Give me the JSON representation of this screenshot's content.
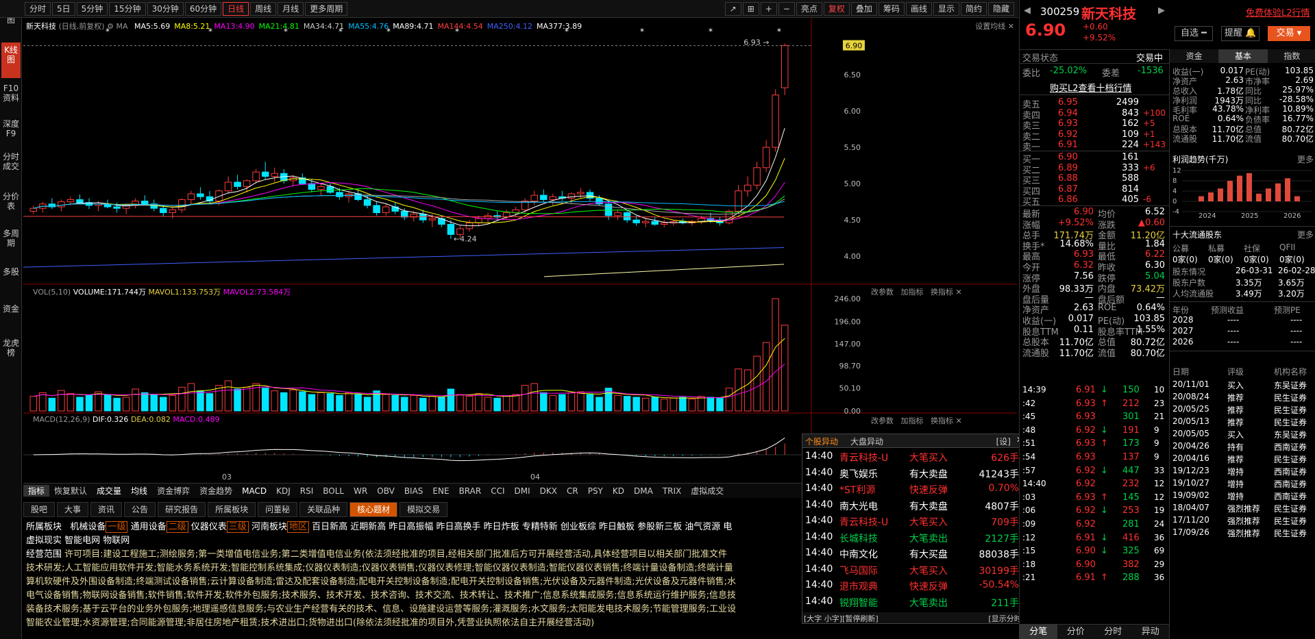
{
  "toolbar": {
    "periods": [
      "分时",
      "5日",
      "5分钟",
      "15分钟",
      "30分钟",
      "60分钟",
      "日线",
      "周线",
      "月线",
      "更多周期"
    ],
    "active_period": "日线",
    "right": [
      "亮点",
      "复权",
      "叠加",
      "筹码",
      "画线",
      "显示",
      "简约",
      "隐藏"
    ]
  },
  "leftnav": [
    "分时图",
    "K线图",
    "F10资料",
    "深度F9",
    "分时成交",
    "分价表",
    "多周期",
    "多股",
    "资金",
    "龙虎榜"
  ],
  "kchart": {
    "title": "新天科技",
    "subtitle": "(日线,前复权)",
    "ma_label": "MA",
    "ma": [
      {
        "name": "MA5",
        "value": "5.69",
        "color": "#ffffff"
      },
      {
        "name": "MA8",
        "value": "5.21",
        "color": "#ffff00"
      },
      {
        "name": "MA13",
        "value": "4.90",
        "color": "#ff00ff"
      },
      {
        "name": "MA21",
        "value": "4.81",
        "color": "#00ff00"
      },
      {
        "name": "MA34",
        "value": "4.71",
        "color": "#cccccc"
      },
      {
        "name": "MA55",
        "value": "4.76",
        "color": "#00bfff"
      },
      {
        "name": "MA89",
        "value": "4.71",
        "color": "#ffffff"
      },
      {
        "name": "MA144",
        "value": "4.54",
        "color": "#ff4040"
      },
      {
        "name": "MA250",
        "value": "4.12",
        "color": "#4060ff"
      },
      {
        "name": "MA377",
        "value": "3.89",
        "color": "#ffffff"
      }
    ],
    "settings_label": "设置均线",
    "price_axis": [
      "6.90",
      "6.50",
      "6.00",
      "5.50",
      "5.00",
      "4.50",
      "4.00"
    ],
    "high_label": "6.93",
    "low_label": "4.24",
    "highlight_price": "6.90",
    "ylim": [
      3.7,
      7.0
    ]
  },
  "volchart": {
    "label": "VOL(5,10)",
    "volume": "VOLUME:171.744万",
    "mavol1": "MAVOL1:133.753万",
    "mavol2": "MAVOL2:73.584万",
    "axis": [
      "246.00",
      "196.00",
      "147.00",
      "98.70",
      "50.10",
      "0.00"
    ],
    "actions": [
      "改参数",
      "加指标",
      "换指标"
    ],
    "ylim": [
      0,
      246
    ]
  },
  "macdchart": {
    "label": "MACD(12,26,9)",
    "dif": "DIF:0.326",
    "dea": "DEA:0.082",
    "macd": "MACD:0.489",
    "actions": [
      "改参数",
      "加指标",
      "换指标"
    ],
    "x_labels": [
      "03",
      "04"
    ]
  },
  "indicators": [
    "指标",
    "恢复默认",
    "成交量",
    "均线",
    "资金博弈",
    "资金趋势",
    "MACD",
    "KDJ",
    "RSI",
    "BOLL",
    "WR",
    "OBV",
    "BIAS",
    "ENE",
    "BRAR",
    "CCI",
    "DMI",
    "DKX",
    "CR",
    "PSY",
    "KD",
    "DMA",
    "TRIX",
    "虚拟成交"
  ],
  "f10_tabs": [
    "股吧",
    "大事",
    "资讯",
    "公告",
    "研究报告",
    "所属板块",
    "问董秘",
    "关联品种",
    "核心题材",
    "模拟交易"
  ],
  "f10_active": "核心题材",
  "f10": {
    "sector_label": "所属板块",
    "sectors": [
      {
        "name": "机械设备",
        "tag": "一级"
      },
      {
        "name": "通用设备",
        "tag": "二级"
      },
      {
        "name": "仪器仪表",
        "tag": "三级"
      },
      {
        "name": "河南板块",
        "tag": "地区"
      }
    ],
    "concepts": "百日新高  近期新高  昨日高振幅  昨日高换手  昨日炸板  专精特新  创业板综  昨日触板  参股新三板  油气资源  电",
    "concepts2": "虚拟现实  智能电网  物联网",
    "scope_label": "经营范围",
    "scope_lines": [
      "许可项目:建设工程施工;测绘服务;第一类增值电信业务;第二类增值电信业务(依法须经批准的项目,经相关部门批准后方可开展经营活动,具体经营项目以相关部门批准文件",
      "技术研发;人工智能应用软件开发;智能水务系统开发;智能控制系统集成;仪器仪表制造;仪器仪表销售;仪器仪表修理;智能仪器仪表制造;智能仪器仪表销售;终端计量设备制造;终端计量",
      "算机软硬件及外围设备制造;终端测试设备销售;云计算设备制造;雷达及配套设备制造;配电开关控制设备制造;配电开关控制设备销售;光伏设备及元器件制造;光伏设备及元器件销售;水",
      "电气设备销售;物联网设备销售;软件销售;软件开发;软件外包服务;技术服务、技术开发、技术咨询、技术交流、技术转让、技术推广;信息系统集成服务;信息系统运行维护服务;信息技",
      "装备技术服务;基于云平台的业务外包服务;地理遥感信息服务;与农业生产经营有关的技术、信息、设施建设运营等服务;灌溉服务;水文服务;太阳能发电技术服务;节能管理服务;工业设",
      "智能农业管理;水资源管理;合同能源管理;非居住房地产租赁;技术进出口;货物进出口(除依法须经批准的项目外,凭营业执照依法自主开展经营活动)"
    ]
  },
  "popup": {
    "tabs": [
      "个股异动",
      "大盘异动"
    ],
    "settings": "[设]",
    "rows": [
      {
        "time": "14:40",
        "name": "青云科技-U",
        "type": "大笔买入",
        "value": "626手",
        "color": "red"
      },
      {
        "time": "14:40",
        "name": "奥飞娱乐",
        "type": "有大卖盘",
        "value": "41243手",
        "color": "white"
      },
      {
        "time": "14:40",
        "name": "*ST利源",
        "type": "快速反弹",
        "value": "0.70%",
        "color": "red"
      },
      {
        "time": "14:40",
        "name": "南大光电",
        "type": "有大卖盘",
        "value": "4807手",
        "color": "white"
      },
      {
        "time": "14:40",
        "name": "青云科技-U",
        "type": "大笔买入",
        "value": "709手",
        "color": "red"
      },
      {
        "time": "14:40",
        "name": "长城科技",
        "type": "大笔卖出",
        "value": "2127手",
        "color": "green"
      },
      {
        "time": "14:40",
        "name": "中南文化",
        "type": "有大买盘",
        "value": "88038手",
        "color": "white"
      },
      {
        "time": "14:40",
        "name": "飞马国际",
        "type": "大笔买入",
        "value": "30199手",
        "color": "red"
      },
      {
        "time": "14:40",
        "name": "退市观典",
        "type": "快速反弹",
        "value": "-50.54%",
        "color": "red"
      },
      {
        "time": "14:40",
        "name": "锐翔智能",
        "type": "大笔卖出",
        "value": "211手",
        "color": "green"
      }
    ],
    "footer_left": "[大字 小字][暂停刷新]",
    "footer_right": "[显示分时]"
  },
  "quote": {
    "code": "300259",
    "name": "新天科技",
    "price": "6.90",
    "change": "+0.60",
    "change_pct": "+9.52%",
    "free_l2": "免费体验L2行情",
    "buttons": [
      "自选",
      "提醒",
      "交易"
    ],
    "trade_status_label": "交易状态",
    "trade_status": "交易中",
    "weibi_label": "委比",
    "weibi": "-25.02%",
    "weicha_label": "委差",
    "weicha": "-1536",
    "buy_l2": "购买L2查看十档行情",
    "asks": [
      {
        "label": "卖五",
        "price": "6.95",
        "vol": "2499",
        "chg": ""
      },
      {
        "label": "卖四",
        "price": "6.94",
        "vol": "843",
        "chg": "+100"
      },
      {
        "label": "卖三",
        "price": "6.93",
        "vol": "162",
        "chg": "+5"
      },
      {
        "label": "卖二",
        "price": "6.92",
        "vol": "109",
        "chg": "+1"
      },
      {
        "label": "卖一",
        "price": "6.91",
        "vol": "224",
        "chg": "+143"
      }
    ],
    "bids": [
      {
        "label": "买一",
        "price": "6.90",
        "vol": "161",
        "chg": ""
      },
      {
        "label": "买二",
        "price": "6.89",
        "vol": "333",
        "chg": "+6"
      },
      {
        "label": "买三",
        "price": "6.88",
        "vol": "588",
        "chg": ""
      },
      {
        "label": "买四",
        "price": "6.87",
        "vol": "814",
        "chg": ""
      },
      {
        "label": "买五",
        "price": "6.86",
        "vol": "405",
        "chg": "-6"
      }
    ],
    "stats": [
      [
        "最新",
        "6.90",
        "均价",
        "6.52"
      ],
      [
        "涨幅",
        "+9.52%",
        "涨跌",
        "▲0.60"
      ],
      [
        "总手",
        "171.74万",
        "金额",
        "11.20亿"
      ],
      [
        "换手*",
        "14.68%",
        "量比",
        "1.84"
      ],
      [
        "最高",
        "6.93",
        "最低",
        "6.22"
      ],
      [
        "今开",
        "6.32",
        "昨收",
        "6.30"
      ],
      [
        "涨停",
        "7.56",
        "跌停",
        "5.04"
      ],
      [
        "外盘",
        "98.33万",
        "内盘",
        "73.42万"
      ],
      [
        "盘后量",
        "—",
        "盘后额",
        "—"
      ],
      [
        "净资产",
        "2.63",
        "ROE",
        "0.64%"
      ],
      [
        "收益(一)",
        "0.017",
        "PE(动)",
        "103.85"
      ],
      [
        "股息TTM",
        "0.11",
        "股息率TTM",
        "1.55%"
      ],
      [
        "总股本",
        "11.70亿",
        "总值",
        "80.72亿"
      ],
      [
        "流通股",
        "11.70亿",
        "流值",
        "80.70亿"
      ]
    ]
  },
  "ticks": [
    {
      "time": "14:39",
      "price": "6.91",
      "arrow": "↓",
      "vol": "150",
      "n": "10"
    },
    {
      "time": ":42",
      "price": "6.93",
      "arrow": "↑",
      "vol": "212",
      "n": "23"
    },
    {
      "time": ":45",
      "price": "6.93",
      "arrow": "",
      "vol": "301",
      "n": "21"
    },
    {
      "time": ":48",
      "price": "6.92",
      "arrow": "↓",
      "vol": "191",
      "n": "9"
    },
    {
      "time": ":51",
      "price": "6.93",
      "arrow": "↑",
      "vol": "173",
      "n": "9"
    },
    {
      "time": ":54",
      "price": "6.93",
      "arrow": "",
      "vol": "137",
      "n": "9"
    },
    {
      "time": ":57",
      "price": "6.92",
      "arrow": "↓",
      "vol": "447",
      "n": "33"
    },
    {
      "time": "14:40",
      "price": "6.92",
      "arrow": "",
      "vol": "232",
      "n": "12"
    },
    {
      "time": ":03",
      "price": "6.93",
      "arrow": "↑",
      "vol": "145",
      "n": "12"
    },
    {
      "time": ":06",
      "price": "6.92",
      "arrow": "↓",
      "vol": "253",
      "n": "19"
    },
    {
      "time": ":09",
      "price": "6.92",
      "arrow": "",
      "vol": "281",
      "n": "24"
    },
    {
      "time": ":12",
      "price": "6.91",
      "arrow": "↓",
      "vol": "416",
      "n": "36"
    },
    {
      "time": ":15",
      "price": "6.90",
      "arrow": "↓",
      "vol": "325",
      "n": "69"
    },
    {
      "time": ":18",
      "price": "6.90",
      "arrow": "",
      "vol": "382",
      "n": "29"
    },
    {
      "time": ":21",
      "price": "6.91",
      "arrow": "↑",
      "vol": "288",
      "n": "36"
    }
  ],
  "tick_tabs": [
    "分笔",
    "分价",
    "分时",
    "异动"
  ],
  "fundamentals": {
    "tabs": [
      "资金",
      "基本",
      "指数"
    ],
    "active": "基本",
    "rows": [
      [
        "收益(一)",
        "0.017",
        "PE(动)",
        "103.85"
      ],
      [
        "净资产",
        "2.63",
        "市净率",
        "2.69"
      ],
      [
        "总收入",
        "1.78亿",
        "同比",
        "25.97%"
      ],
      [
        "净利润",
        "1943万",
        "同比",
        "-28.58%"
      ],
      [
        "毛利率",
        "43.78%",
        "净利率",
        "10.89%"
      ],
      [
        "ROE",
        "0.64%",
        "负债率",
        "16.77%"
      ],
      [
        "总股本",
        "11.70亿",
        "总值",
        "80.72亿"
      ],
      [
        "流通股",
        "11.70亿",
        "流值",
        "80.70亿"
      ]
    ],
    "profit_title": "利润趋势(千万)",
    "more": "更多",
    "profit_axis": [
      "12",
      "8",
      "4",
      "0",
      "-4"
    ],
    "profit_years": [
      "2024",
      "2025",
      "2026"
    ],
    "profit_bars": [
      2,
      3.5,
      5,
      8,
      10,
      11,
      3,
      5,
      7,
      9,
      2
    ]
  },
  "holders": {
    "title": "十大流通股东",
    "more": "更多",
    "types": [
      "公募",
      "私募",
      "社保",
      "QFII"
    ],
    "counts": [
      "0家(0)",
      "0家(0)",
      "0家(0)",
      "0家(0)"
    ],
    "rows": [
      [
        "股东情况",
        "26-03-31",
        "26-02-28"
      ],
      [
        "股东户数",
        "3.35万",
        "3.65万"
      ],
      [
        "人均流通股",
        "3.49万",
        "3.20万"
      ]
    ]
  },
  "forecast": {
    "head": [
      "年份",
      "预测收益",
      "预测PE"
    ],
    "rows": [
      [
        "2028",
        "----",
        "----"
      ],
      [
        "2027",
        "----",
        "----"
      ],
      [
        "2026",
        "----",
        "----"
      ]
    ]
  },
  "ratings": {
    "head": [
      "日期",
      "评级",
      "机构名称"
    ],
    "rows": [
      [
        "20/11/01",
        "买入",
        "东吴证券"
      ],
      [
        "20/08/24",
        "推荐",
        "民生证券"
      ],
      [
        "20/05/25",
        "推荐",
        "民生证券"
      ],
      [
        "20/05/13",
        "推荐",
        "民生证券"
      ],
      [
        "20/05/05",
        "买入",
        "东吴证券"
      ],
      [
        "20/04/26",
        "持有",
        "西南证券"
      ],
      [
        "20/04/16",
        "推荐",
        "民生证券"
      ],
      [
        "19/12/23",
        "增持",
        "西南证券"
      ],
      [
        "19/10/27",
        "增持",
        "西南证券"
      ],
      [
        "19/09/02",
        "增持",
        "西南证券"
      ],
      [
        "18/04/07",
        "强烈推荐",
        "民生证券"
      ],
      [
        "17/11/20",
        "强烈推荐",
        "民生证券"
      ],
      [
        "17/09/26",
        "强烈推荐",
        "民生证券"
      ]
    ]
  },
  "chart_data": {
    "type": "candlestick",
    "ylim": [
      3.7,
      7.0
    ],
    "candles": [
      [
        4.62,
        4.7,
        4.58,
        4.66
      ],
      [
        4.66,
        4.75,
        4.6,
        4.72
      ],
      [
        4.72,
        4.8,
        4.65,
        4.68
      ],
      [
        4.68,
        4.78,
        4.62,
        4.75
      ],
      [
        4.75,
        4.82,
        4.7,
        4.78
      ],
      [
        4.78,
        4.85,
        4.72,
        4.74
      ],
      [
        4.74,
        4.8,
        4.65,
        4.7
      ],
      [
        4.7,
        4.76,
        4.62,
        4.72
      ],
      [
        4.72,
        4.78,
        4.66,
        4.68
      ],
      [
        4.68,
        4.74,
        4.6,
        4.66
      ],
      [
        4.66,
        4.72,
        4.58,
        4.7
      ],
      [
        4.7,
        4.8,
        4.66,
        4.76
      ],
      [
        4.76,
        4.84,
        4.7,
        4.72
      ],
      [
        4.72,
        4.78,
        4.62,
        4.66
      ],
      [
        4.66,
        4.7,
        4.55,
        4.6
      ],
      [
        4.6,
        4.68,
        4.52,
        4.64
      ],
      [
        4.64,
        4.8,
        4.6,
        4.78
      ],
      [
        4.78,
        4.9,
        4.72,
        4.86
      ],
      [
        4.86,
        4.95,
        4.78,
        4.82
      ],
      [
        4.82,
        4.9,
        4.72,
        4.76
      ],
      [
        4.76,
        4.92,
        4.7,
        4.9
      ],
      [
        4.9,
        5.1,
        4.86,
        5.02
      ],
      [
        5.02,
        5.12,
        4.92,
        4.96
      ],
      [
        4.96,
        5.06,
        4.88,
        5.04
      ],
      [
        5.04,
        5.2,
        5.0,
        5.16
      ],
      [
        5.16,
        5.3,
        5.06,
        5.1
      ],
      [
        5.1,
        5.22,
        5.02,
        5.14
      ],
      [
        5.14,
        5.2,
        5.0,
        5.04
      ],
      [
        5.04,
        5.12,
        4.96,
        5.08
      ],
      [
        5.08,
        5.14,
        4.98,
        5.0
      ],
      [
        5.0,
        5.06,
        4.88,
        4.92
      ],
      [
        4.92,
        5.0,
        4.84,
        4.96
      ],
      [
        4.96,
        5.02,
        4.86,
        4.88
      ],
      [
        4.88,
        4.94,
        4.78,
        4.82
      ],
      [
        4.82,
        4.9,
        4.74,
        4.86
      ],
      [
        4.86,
        4.92,
        4.76,
        4.78
      ],
      [
        4.78,
        4.84,
        4.66,
        4.7
      ],
      [
        4.7,
        4.76,
        4.56,
        4.6
      ],
      [
        4.6,
        4.72,
        4.56,
        4.68
      ],
      [
        4.68,
        4.74,
        4.58,
        4.62
      ],
      [
        4.62,
        4.66,
        4.5,
        4.54
      ],
      [
        4.54,
        4.62,
        4.48,
        4.58
      ],
      [
        4.58,
        4.64,
        4.46,
        4.5
      ],
      [
        4.5,
        4.58,
        4.4,
        4.52
      ],
      [
        4.52,
        4.56,
        4.4,
        4.44
      ],
      [
        4.44,
        4.5,
        4.24,
        4.3
      ],
      [
        4.3,
        4.42,
        4.24,
        4.38
      ],
      [
        4.38,
        4.5,
        4.34,
        4.46
      ],
      [
        4.46,
        4.56,
        4.42,
        4.52
      ],
      [
        4.52,
        4.6,
        4.46,
        4.56
      ],
      [
        4.56,
        4.62,
        4.5,
        4.54
      ],
      [
        4.54,
        4.64,
        4.5,
        4.6
      ],
      [
        4.6,
        4.68,
        4.54,
        4.64
      ],
      [
        4.64,
        4.8,
        4.6,
        4.76
      ],
      [
        4.76,
        4.9,
        4.7,
        4.84
      ],
      [
        4.84,
        4.92,
        4.74,
        4.78
      ],
      [
        4.78,
        4.86,
        4.7,
        4.82
      ],
      [
        4.82,
        4.9,
        4.76,
        4.8
      ],
      [
        4.8,
        4.88,
        4.72,
        4.86
      ],
      [
        4.86,
        4.94,
        4.8,
        4.88
      ],
      [
        4.88,
        4.92,
        4.76,
        4.8
      ],
      [
        4.8,
        4.84,
        4.7,
        4.72
      ],
      [
        4.72,
        4.76,
        4.5,
        4.56
      ],
      [
        4.56,
        4.64,
        4.5,
        4.6
      ],
      [
        4.6,
        4.64,
        4.46,
        4.5
      ],
      [
        4.5,
        4.56,
        4.42,
        4.46
      ],
      [
        4.46,
        4.52,
        4.4,
        4.48
      ],
      [
        4.48,
        4.54,
        4.42,
        4.44
      ],
      [
        4.44,
        4.5,
        4.4,
        4.46
      ],
      [
        4.46,
        4.5,
        4.42,
        4.48
      ],
      [
        4.48,
        4.52,
        4.44,
        4.46
      ],
      [
        4.46,
        4.5,
        4.42,
        4.48
      ],
      [
        4.48,
        4.56,
        4.44,
        4.52
      ],
      [
        4.52,
        4.6,
        4.46,
        4.5
      ],
      [
        4.5,
        4.54,
        4.42,
        4.46
      ],
      [
        4.46,
        4.64,
        4.44,
        4.62
      ],
      [
        4.62,
        4.98,
        4.58,
        4.9
      ],
      [
        4.9,
        5.1,
        4.82,
        4.98
      ],
      [
        4.98,
        5.3,
        4.92,
        5.22
      ],
      [
        5.22,
        5.6,
        5.16,
        5.5
      ],
      [
        5.5,
        6.3,
        5.44,
        6.22
      ],
      [
        6.32,
        6.93,
        6.22,
        6.9
      ]
    ]
  },
  "vol_data": [
    32,
    40,
    28,
    45,
    38,
    30,
    35,
    42,
    36,
    28,
    30,
    48,
    40,
    36,
    30,
    34,
    52,
    60,
    44,
    38,
    56,
    66,
    48,
    52,
    60,
    50,
    44,
    40,
    46,
    42,
    36,
    40,
    38,
    34,
    40,
    36,
    30,
    44,
    36,
    34,
    30,
    34,
    28,
    32,
    30,
    48,
    36,
    32,
    38,
    30,
    28,
    32,
    36,
    56,
    60,
    40,
    34,
    36,
    40,
    42,
    36,
    30,
    50,
    34,
    32,
    30,
    28,
    30,
    26,
    28,
    30,
    26,
    32,
    30,
    28,
    50,
    92,
    90,
    120,
    150,
    246,
    188
  ]
}
